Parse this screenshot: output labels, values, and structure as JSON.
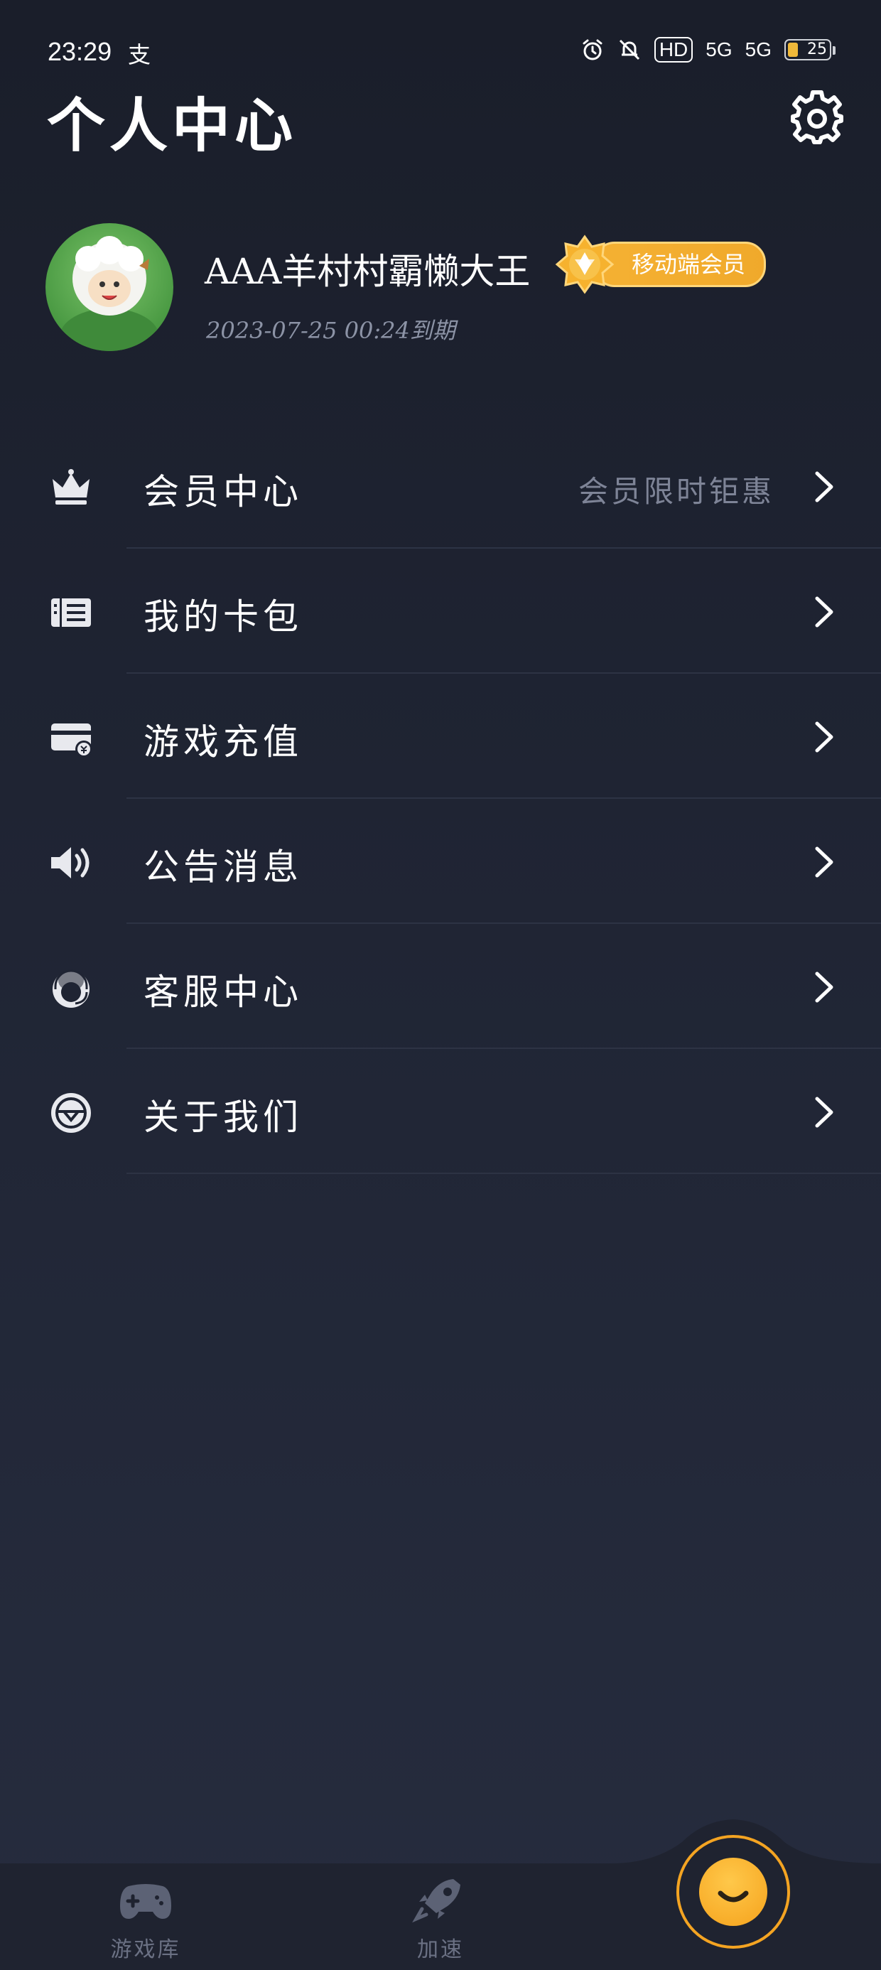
{
  "status_bar": {
    "time": "23:29",
    "carrier_icon": "支",
    "hd_label": "HD",
    "net1": "5G",
    "net2": "5G",
    "battery": "25"
  },
  "header": {
    "title": "个人中心",
    "settings_icon": "gear-icon"
  },
  "profile": {
    "username": "AAA羊村村霸懒大王",
    "badge": "移动端会员",
    "expire": "2023-07-25 00:24到期"
  },
  "menu": {
    "items": [
      {
        "label": "会员中心",
        "hint": "会员限时钜惠",
        "icon": "crown-icon"
      },
      {
        "label": "我的卡包",
        "hint": "",
        "icon": "card-wallet-icon"
      },
      {
        "label": "游戏充值",
        "hint": "",
        "icon": "recharge-card-icon"
      },
      {
        "label": "公告消息",
        "hint": "",
        "icon": "speaker-icon"
      },
      {
        "label": "客服中心",
        "hint": "",
        "icon": "customer-service-icon"
      },
      {
        "label": "关于我们",
        "hint": "",
        "icon": "about-logo-icon"
      }
    ]
  },
  "tabbar": {
    "tabs": [
      {
        "label": "游戏库",
        "icon": "gamepad-icon"
      },
      {
        "label": "加速",
        "icon": "rocket-icon"
      },
      {
        "label": "",
        "icon": "smile-icon"
      }
    ]
  },
  "colors": {
    "accent": "#f5a21c",
    "background": "#1f2433",
    "hint_text": "#7e8497"
  }
}
